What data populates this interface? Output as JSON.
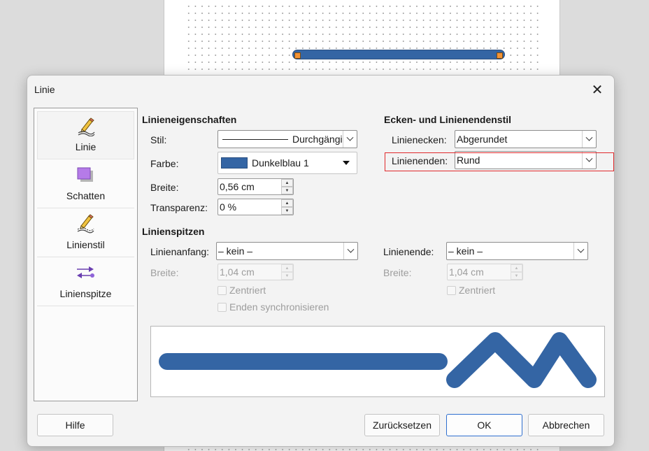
{
  "colors": {
    "accent": "#3465a4",
    "handle": "#f39437",
    "highlight": "#e0292b"
  },
  "dialog": {
    "title": "Linie",
    "close_icon": "close-icon"
  },
  "sidebar": {
    "items": [
      {
        "label": "Linie",
        "icon": "line-pencil-icon"
      },
      {
        "label": "Schatten",
        "icon": "shadow-icon"
      },
      {
        "label": "Linienstil",
        "icon": "line-style-icon"
      },
      {
        "label": "Linienspitze",
        "icon": "arrowheads-icon"
      }
    ]
  },
  "properties": {
    "heading": "Linieneigenschaften",
    "style_label": "Stil:",
    "style_value": "Durchgängig",
    "color_label": "Farbe:",
    "color_value": "Dunkelblau 1",
    "width_label": "Breite:",
    "width_value": "0,56 cm",
    "transparency_label": "Transparenz:",
    "transparency_value": "0 %"
  },
  "corners": {
    "heading": "Ecken- und Linienendenstil",
    "corner_label": "Linienecken:",
    "corner_value": "Abgerundet",
    "cap_label": "Linienenden:",
    "cap_value": "Rund"
  },
  "arrows": {
    "heading": "Linienspitzen",
    "start_label": "Linienanfang:",
    "start_value": "– kein –",
    "start_width_label": "Breite:",
    "start_width_value": "1,04 cm",
    "start_centered": "Zentriert",
    "sync_ends": "Enden synchronisieren",
    "end_label": "Linienende:",
    "end_value": "– kein –",
    "end_width_label": "Breite:",
    "end_width_value": "1,04 cm",
    "end_centered": "Zentriert"
  },
  "buttons": {
    "help": "Hilfe",
    "reset": "Zurücksetzen",
    "ok": "OK",
    "cancel": "Abbrechen"
  }
}
